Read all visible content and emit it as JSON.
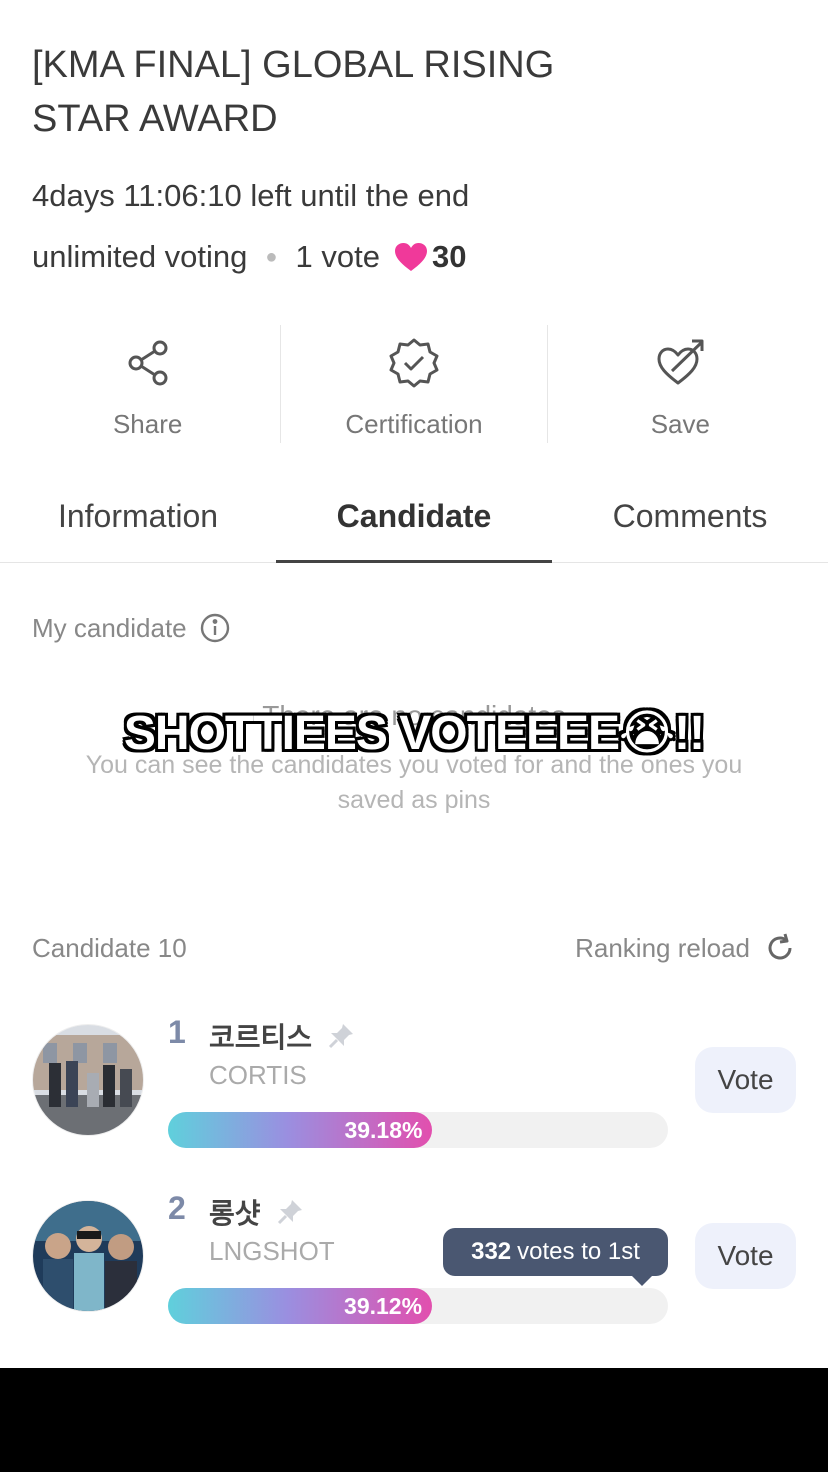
{
  "event": {
    "title": "[KMA FINAL] GLOBAL RISING STAR AWARD",
    "countdown": "4days 11:06:10 left until the end",
    "voting_mode": "unlimited voting",
    "cost_label": "1 vote",
    "heart_cost": "30"
  },
  "actions": [
    {
      "label": "Share",
      "icon": "share-icon"
    },
    {
      "label": "Certification",
      "icon": "certification-badge-icon"
    },
    {
      "label": "Save",
      "icon": "heart-arrow-icon"
    }
  ],
  "tabs": [
    {
      "label": "Information",
      "active": false
    },
    {
      "label": "Candidate",
      "active": true
    },
    {
      "label": "Comments",
      "active": false
    }
  ],
  "my_candidate": {
    "label": "My candidate",
    "empty_title": "There are no candidates",
    "empty_desc": "You can see the candidates you voted for and the ones you saved as pins"
  },
  "overlay_caption": "SHOTTIEES VOTEEEE😭!!",
  "list": {
    "count_label": "Candidate 10",
    "reload_label": "Ranking reload"
  },
  "candidates": [
    {
      "rank": "1",
      "name_kr": "코르티스",
      "name_en": "CORTIS",
      "percent_label": "39.18%",
      "percent": 39.18,
      "vote_label": "Vote"
    },
    {
      "rank": "2",
      "name_kr": "롱샷",
      "name_en": "LNGSHOT",
      "percent_label": "39.12%",
      "percent": 39.12,
      "vote_label": "Vote"
    }
  ],
  "gap_tooltip": {
    "count": "332",
    "suffix": "votes to 1st"
  },
  "colors": {
    "heart": "#f0399a",
    "bar_start": "#5fd0dc",
    "bar_end": "#e24fae",
    "tooltip_bg": "#4a5771"
  }
}
